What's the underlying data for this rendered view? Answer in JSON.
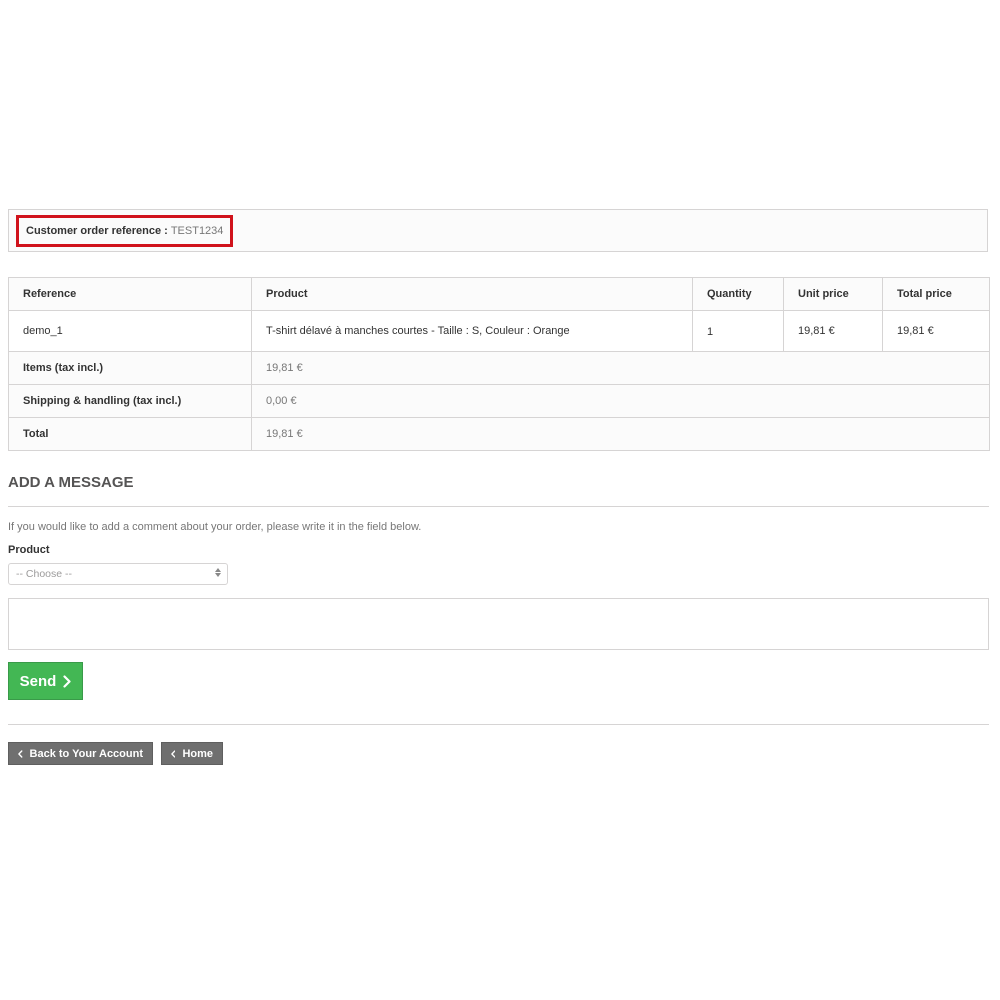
{
  "order_reference": {
    "label": "Customer order reference :",
    "value": "TEST1234"
  },
  "order_table": {
    "columns": [
      "Reference",
      "Product",
      "Quantity",
      "Unit price",
      "Total price"
    ],
    "items": [
      {
        "reference": "demo_1",
        "product": "T-shirt délavé à manches courtes - Taille : S, Couleur : Orange",
        "quantity": "1",
        "unit_price": "19,81 €",
        "total_price": "19,81 €"
      }
    ],
    "totals": [
      {
        "label": "Items (tax incl.)",
        "value": "19,81 €"
      },
      {
        "label": "Shipping & handling (tax incl.)",
        "value": "0,00 €"
      },
      {
        "label": "Total",
        "value": "19,81 €"
      }
    ]
  },
  "message_section": {
    "title": "Add a message",
    "help_text": "If you would like to add a comment about your order, please write it in the field below.",
    "product_label": "Product",
    "product_select_value": "-- Choose --",
    "message_value": "",
    "send_label": "Send"
  },
  "footer_nav": {
    "back_label": "Back to Your Account",
    "home_label": "Home"
  },
  "colors": {
    "highlight_border": "#d0121b",
    "send_button": "#43b754",
    "nav_button": "#6f6f6f"
  },
  "icons": [
    "chevron-right-icon",
    "chevron-left-icon",
    "select-arrows-icon"
  ]
}
